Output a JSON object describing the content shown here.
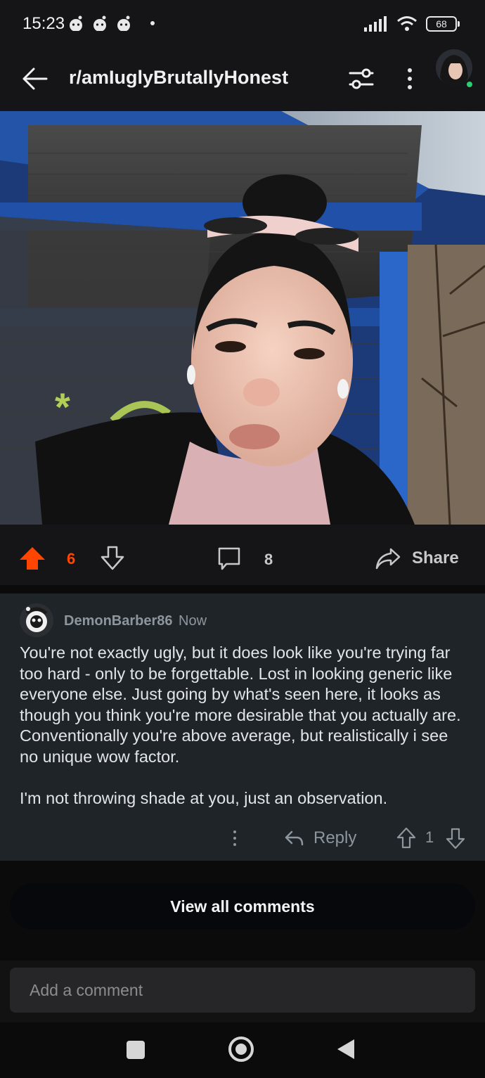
{
  "status_bar": {
    "time": "15:23",
    "battery": "68",
    "icons": [
      "reddit-notification-icon",
      "reddit-notification-icon",
      "reddit-notification-icon",
      "dot-icon",
      "signal-icon",
      "wifi-icon",
      "battery-icon"
    ]
  },
  "header": {
    "title": "r/amIuglyBrutallyHonest",
    "icons": [
      "back-arrow-icon",
      "filter-icon",
      "more-vertical-icon",
      "profile-avatar"
    ]
  },
  "post": {
    "image_alt": "",
    "votes": "6",
    "comments_count": "8",
    "share_label": "Share",
    "colors": {
      "upvote_active": "#ff4500"
    }
  },
  "comment": {
    "author": "DemonBarber86",
    "time": "Now",
    "paragraphs": [
      "You're not exactly ugly, but it does look like you're trying far too hard - only to be forgettable. Lost in looking generic like everyone else. Just going by what's seen here, it looks as though you think you're more desirable that you actually are. Conventionally you're above average, but realistically i see no unique wow factor.",
      "I'm not throwing shade at you, just an observation."
    ],
    "reply_label": "Reply",
    "votes": "1"
  },
  "view_all_label": "View all comments",
  "comment_input": {
    "placeholder": "Add a comment"
  },
  "nav": {
    "icons": [
      "recent-apps-icon",
      "home-icon",
      "back-icon"
    ]
  }
}
